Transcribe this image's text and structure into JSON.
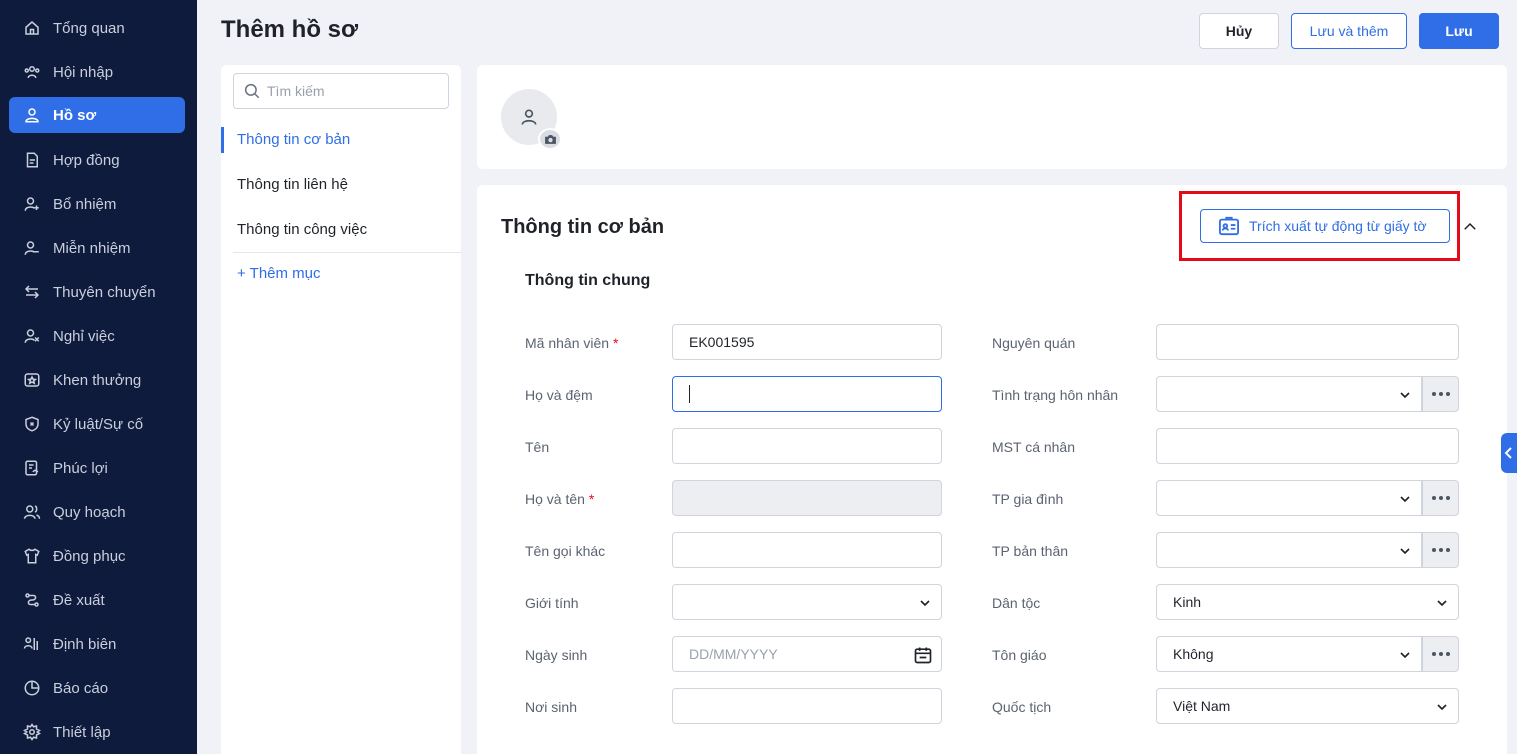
{
  "sidebar": {
    "items": [
      {
        "label": "Tổng quan",
        "icon": "home-icon"
      },
      {
        "label": "Hội nhập",
        "icon": "people-icon"
      },
      {
        "label": "Hồ sơ",
        "icon": "user-icon",
        "active": true
      },
      {
        "label": "Hợp đồng",
        "icon": "document-icon"
      },
      {
        "label": "Bổ nhiệm",
        "icon": "user-plus-icon"
      },
      {
        "label": "Miễn nhiệm",
        "icon": "user-minus-icon"
      },
      {
        "label": "Thuyên chuyển",
        "icon": "transfer-icon"
      },
      {
        "label": "Nghỉ việc",
        "icon": "user-x-icon"
      },
      {
        "label": "Khen thưởng",
        "icon": "award-icon"
      },
      {
        "label": "Kỷ luật/Sự cố",
        "icon": "shield-icon"
      },
      {
        "label": "Phúc lợi",
        "icon": "benefit-icon"
      },
      {
        "label": "Quy hoạch",
        "icon": "users-icon"
      },
      {
        "label": "Đồng phục",
        "icon": "shirt-icon"
      },
      {
        "label": "Đề xuất",
        "icon": "proposal-icon"
      },
      {
        "label": "Định biên",
        "icon": "headcount-icon"
      },
      {
        "label": "Báo cáo",
        "icon": "report-icon"
      },
      {
        "label": "Thiết lập",
        "icon": "gear-icon"
      }
    ]
  },
  "header": {
    "title": "Thêm hồ sơ",
    "cancel_label": "Hủy",
    "save_add_label": "Lưu và thêm",
    "save_label": "Lưu"
  },
  "left_panel": {
    "search_placeholder": "Tìm kiếm",
    "sections": [
      "Thông tin cơ bản",
      "Thông tin liên hệ",
      "Thông tin công việc"
    ],
    "add_section_label": "+ Thêm mục"
  },
  "basic_info": {
    "title": "Thông tin cơ bản",
    "extract_label": "Trích xuất tự động từ giấy tờ",
    "subsection": "Thông tin chung",
    "left_fields": [
      {
        "label": "Mã nhân viên",
        "required": "*",
        "value": "EK001595"
      },
      {
        "label": "Họ và đệm",
        "value": ""
      },
      {
        "label": "Tên",
        "value": ""
      },
      {
        "label": "Họ và tên",
        "required": "*",
        "value": ""
      },
      {
        "label": "Tên gọi khác",
        "value": ""
      },
      {
        "label": "Giới tính",
        "value": ""
      },
      {
        "label": "Ngày sinh",
        "placeholder": "DD/MM/YYYY"
      },
      {
        "label": "Nơi sinh",
        "value": ""
      }
    ],
    "right_fields": [
      {
        "label": "Nguyên quán",
        "value": ""
      },
      {
        "label": "Tình trạng hôn nhân",
        "value": ""
      },
      {
        "label": "MST cá nhân",
        "value": ""
      },
      {
        "label": "TP gia đình",
        "value": ""
      },
      {
        "label": "TP bản thân",
        "value": ""
      },
      {
        "label": "Dân tộc",
        "value": "Kinh"
      },
      {
        "label": "Tôn giáo",
        "value": "Không"
      },
      {
        "label": "Quốc tịch",
        "value": "Việt Nam"
      }
    ]
  },
  "colors": {
    "sidebar_bg": "#0f1b3d",
    "accent": "#2f6ee6",
    "highlight": "#e30b17"
  }
}
